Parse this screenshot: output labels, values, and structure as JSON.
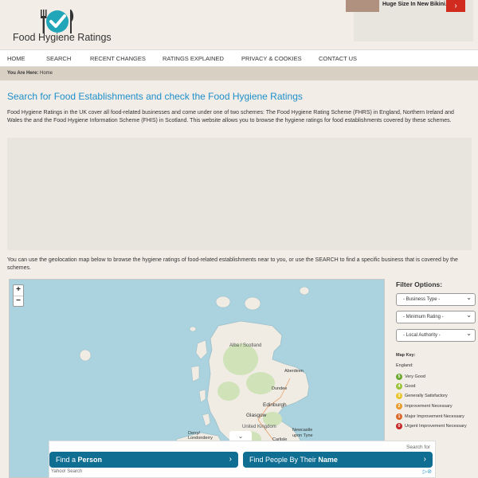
{
  "site": {
    "title": "Food Hygiene Ratings"
  },
  "top_ad": {
    "text": "Huge Size In New Bikini..."
  },
  "nav": {
    "items": [
      "HOME",
      "SEARCH",
      "RECENT CHANGES",
      "RATINGS EXPLAINED",
      "PRIVACY & COOKIES",
      "CONTACT US"
    ]
  },
  "breadcrumb": {
    "label": "You Are Here:",
    "current": "Home"
  },
  "main": {
    "title": "Search for Food Establishments and check the Food Hygiene Ratings",
    "intro": "Food Hygiene Ratings in the UK cover all food-related businesses and come under one of two schemes: The Food Hygiene Rating Scheme (FHRS) in England, Northern Ireland and Wales the and the Food Hygiene Information Scheme (FHIS) in Scotland. This website allows you to browse the hygiene ratings for food establishments covered by these schemes.",
    "geo_text": "You can use the geolocation map below to browse the hygiene ratings of food-related establishments near to you, or use the SEARCH to find a specific business that is covered by the schemes."
  },
  "map": {
    "zoom_in": "+",
    "zoom_out": "−",
    "labels": {
      "alba": "Alba / Scotland",
      "aberdeen": "Aberdeen",
      "dundee": "Dundee",
      "edinburgh": "Edinburgh",
      "glasgow": "Glasgow",
      "uk": "United Kingdom",
      "derry": "Derry/\nLondonderry",
      "newcastle": "Newcastle\nupon Tyne",
      "carlisle": "Carlisle"
    }
  },
  "filters": {
    "title": "Filter Options:",
    "business_type": "- Business Type -",
    "minimum_rating": "- Minimum Rating -",
    "local_authority": "- Local Authority -"
  },
  "map_key": {
    "title": "Map Key:",
    "region": "England:",
    "items": [
      {
        "score": "5",
        "label": "Very Good",
        "color": "#6aa830"
      },
      {
        "score": "4",
        "label": "Good",
        "color": "#9cc43a"
      },
      {
        "score": "3",
        "label": "Generally Satisfactory",
        "color": "#e8c52c"
      },
      {
        "score": "2",
        "label": "Improvement Necessary",
        "color": "#e89a2c"
      },
      {
        "score": "1",
        "label": "Major Improvement Necessary",
        "color": "#d9682a"
      },
      {
        "score": "0",
        "label": "Urgent Improvement Necessary",
        "color": "#c6282a"
      }
    ]
  },
  "bottom_ad": {
    "search_for": "Search for",
    "button1_prefix": "Find a",
    "button1_bold": "Person",
    "button2_prefix": "Find People By Their",
    "button2_bold": "Name",
    "footer": "Yahoo! Search",
    "chevron": "⌄"
  },
  "colors": {
    "accent": "#1d8fcb",
    "logo_teal": "#20a6b8",
    "ad_button": "#0f6e91"
  }
}
